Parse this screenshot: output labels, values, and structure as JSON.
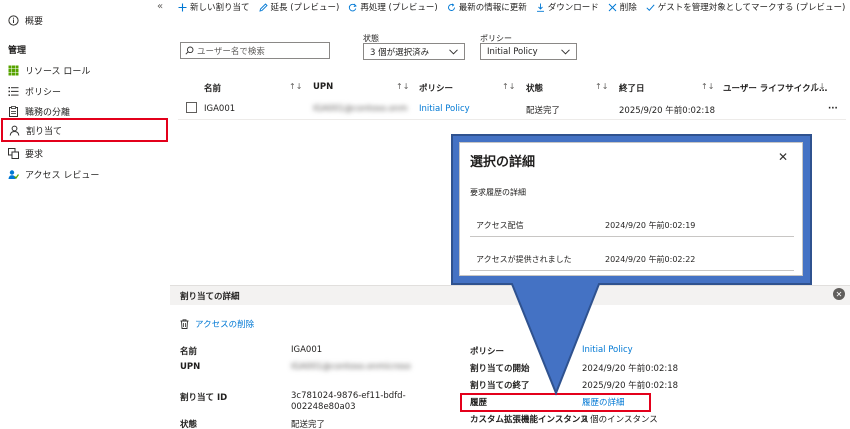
{
  "sidebar": {
    "collapse_glyph": "«",
    "overview": "概要",
    "section_manage": "管理",
    "items": [
      {
        "label": "リソース ロール",
        "icon": "grid-icon"
      },
      {
        "label": "ポリシー",
        "icon": "list-icon"
      },
      {
        "label": "職務の分離",
        "icon": "clipboard-icon"
      },
      {
        "label": "割り当て",
        "icon": "person-icon"
      },
      {
        "label": "要求",
        "icon": "request-icon"
      },
      {
        "label": "アクセス レビュー",
        "icon": "review-icon"
      }
    ]
  },
  "toolbar": {
    "new_assignment": "新しい割り当て",
    "extend": "延長 (プレビュー)",
    "reprocess": "再処理 (プレビュー)",
    "refresh": "最新の情報に更新",
    "download": "ダウンロード",
    "delete": "削除",
    "mark_guest": "ゲストを管理対象としてマークする (プレビュー)"
  },
  "filters": {
    "search_placeholder": "ユーザー名で検索",
    "state_label": "状態",
    "state_value": "3 個が選択済み",
    "policy_label": "ポリシー",
    "policy_value": "Initial Policy"
  },
  "table": {
    "headers": {
      "name": "名前",
      "upn": "UPN",
      "policy": "ポリシー",
      "state": "状態",
      "end_date": "終了日",
      "lifecycle": "ユーザー ライフサイクル…"
    },
    "row": {
      "name": "IGA001",
      "upn": "IGA001@contoso.onmicrosoft.com",
      "policy": "Initial Policy",
      "state": "配送完了",
      "end_date": "2025/9/20 午前0:02:18",
      "more": "···"
    }
  },
  "detail": {
    "title": "割り当ての詳細",
    "remove_access": "アクセスの削除",
    "labels": {
      "name": "名前",
      "upn": "UPN",
      "assignment_id": "割り当て ID",
      "state": "状態",
      "policy": "ポリシー",
      "start": "割り当ての開始",
      "end": "割り当ての終了",
      "history": "履歴",
      "custom_ext": "カスタム拡張機能インスタンス"
    },
    "values": {
      "name": "IGA001",
      "upn": "IGA001@contoso.onmicrosoft.com",
      "assignment_id_1": "3c781024-9876-ef11-bdfd-",
      "assignment_id_2": "002248e80a03",
      "state": "配送完了",
      "policy": "Initial Policy",
      "start": "2024/9/20 午前0:02:18",
      "end": "2025/9/20 午前0:02:18",
      "history": "履歴の詳細",
      "custom_ext": "0 個のインスタンス"
    }
  },
  "popup": {
    "title": "選択の詳細",
    "subtitle": "要求履歴の詳細",
    "rows": [
      {
        "key": "アクセス配信",
        "value": "2024/9/20 午前0:02:19"
      },
      {
        "key": "アクセスが提供されました",
        "value": "2024/9/20 午前0:02:22"
      }
    ]
  },
  "colors": {
    "accent_link": "#0078d4",
    "highlight_red": "#e3001b",
    "callout_blue": "#4472c4",
    "callout_border": "#2f528f"
  }
}
